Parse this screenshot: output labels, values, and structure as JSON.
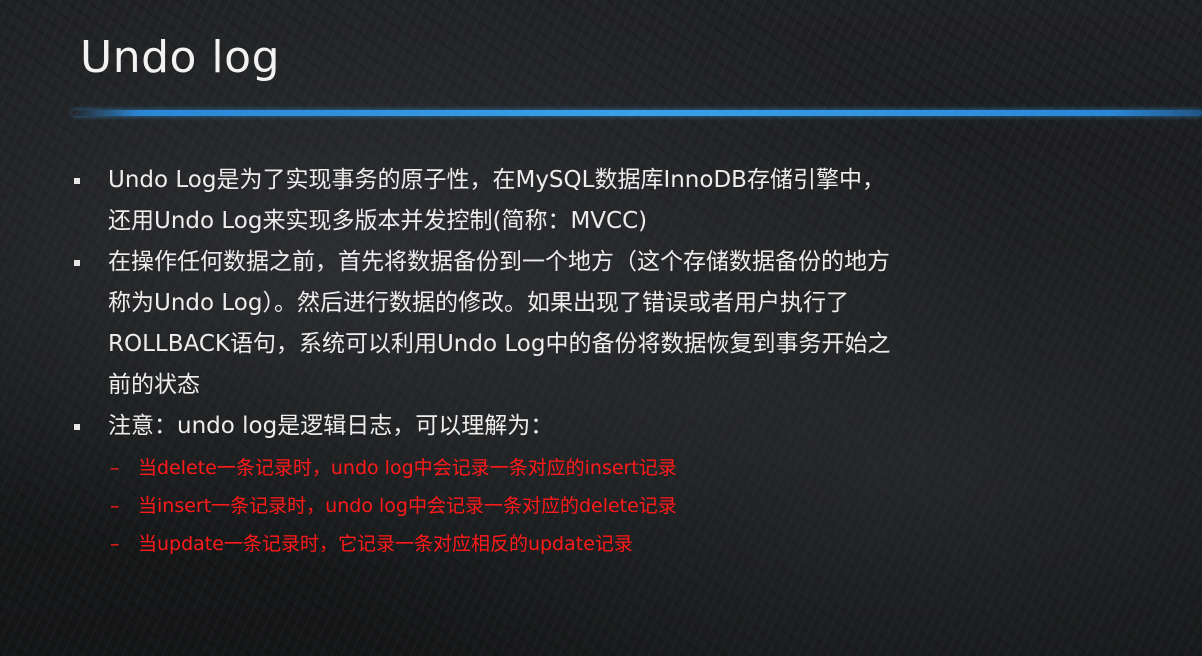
{
  "slide": {
    "title": "Undo log",
    "bullets": [
      {
        "lines": [
          "Undo Log是为了实现事务的原子性，在MySQL数据库InnoDB存储引擎中，",
          "还用Undo Log来实现多版本并发控制(简称：MVCC)"
        ]
      },
      {
        "lines": [
          "在操作任何数据之前，首先将数据备份到一个地方（这个存储数据备份的地方",
          "称为Undo Log）。然后进行数据的修改。如果出现了错误或者用户执行了",
          "ROLLBACK语句，系统可以利用Undo Log中的备份将数据恢复到事务开始之",
          "前的状态"
        ]
      },
      {
        "lines": [
          "注意：undo log是逻辑日志，可以理解为："
        ]
      }
    ],
    "sub_marker": "–",
    "sub_items": [
      "当delete一条记录时，undo log中会记录一条对应的insert记录",
      "当insert一条记录时，undo log中会记录一条对应的delete记录",
      "当update一条记录时，它记录一条对应相反的update记录"
    ]
  },
  "colors": {
    "title_rule": "#3aa0ea",
    "body_text": "#ededed",
    "highlight_text": "#ff1a1a"
  }
}
